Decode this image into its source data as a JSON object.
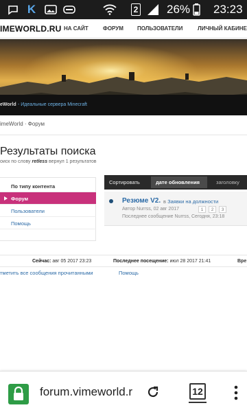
{
  "status_bar": {
    "battery_percent": "26%",
    "time": "23:23",
    "sim_badge": "2",
    "icons": [
      "chat-bubble-icon",
      "vk-k-icon",
      "image-icon",
      "gamepad-icon",
      "wifi-icon",
      "sim-2-icon",
      "signal-icon",
      "battery-icon"
    ]
  },
  "header": {
    "logo": "IMEWORLD.RU",
    "nav": [
      "НА САЙТ",
      "ФОРУМ",
      "ПОЛЬЗОВАТЕЛИ",
      "ЛИЧНЫЙ КАБИНЕТ"
    ]
  },
  "banner": {
    "site_name": "eWorld",
    "tagline": "- Идеальные сервера Minecraft"
  },
  "breadcrumb": "imeWorld · Форум",
  "page": {
    "title": "Результаты поиска",
    "subtitle_prefix": "оиск по слову",
    "search_term": "retless",
    "subtitle_suffix": "вернул 1 результатов"
  },
  "filters": {
    "heading": "По типу контента",
    "items": [
      {
        "label": "Форум",
        "active": true
      },
      {
        "label": "Пользователи",
        "active": false
      },
      {
        "label": "Помощь",
        "active": false
      }
    ]
  },
  "sort": {
    "label": "Сортировать",
    "options": [
      "дате обновления",
      "заголовку"
    ],
    "active": "дате обновления"
  },
  "result": {
    "title": "Резюме V2.",
    "in_prefix": "в",
    "forum": "Заявки на должности",
    "author_line": "Автор Nurrss, 02 авг 2017",
    "pages": [
      "1",
      "2",
      "3"
    ],
    "last_post": "Последнее сообщение Nurrss, Сегодня, 23:18"
  },
  "footer": {
    "now_label": "Сейчас:",
    "now_value": "авг 05 2017 23:23",
    "last_visit_label": "Последнее посещение:",
    "last_visit_value": "июл 28 2017 21:41",
    "tail": "Вре",
    "mark_read": "тметить все сообщения прочитанными",
    "help": "Помощь"
  },
  "browser": {
    "url": "forum.vimeworld.r",
    "tab_count": "12",
    "accent": "#2e9c46"
  },
  "colors": {
    "active_filter": "#c8317b",
    "link": "#2b6aa6",
    "sort_bar": "#2a2a2a"
  }
}
